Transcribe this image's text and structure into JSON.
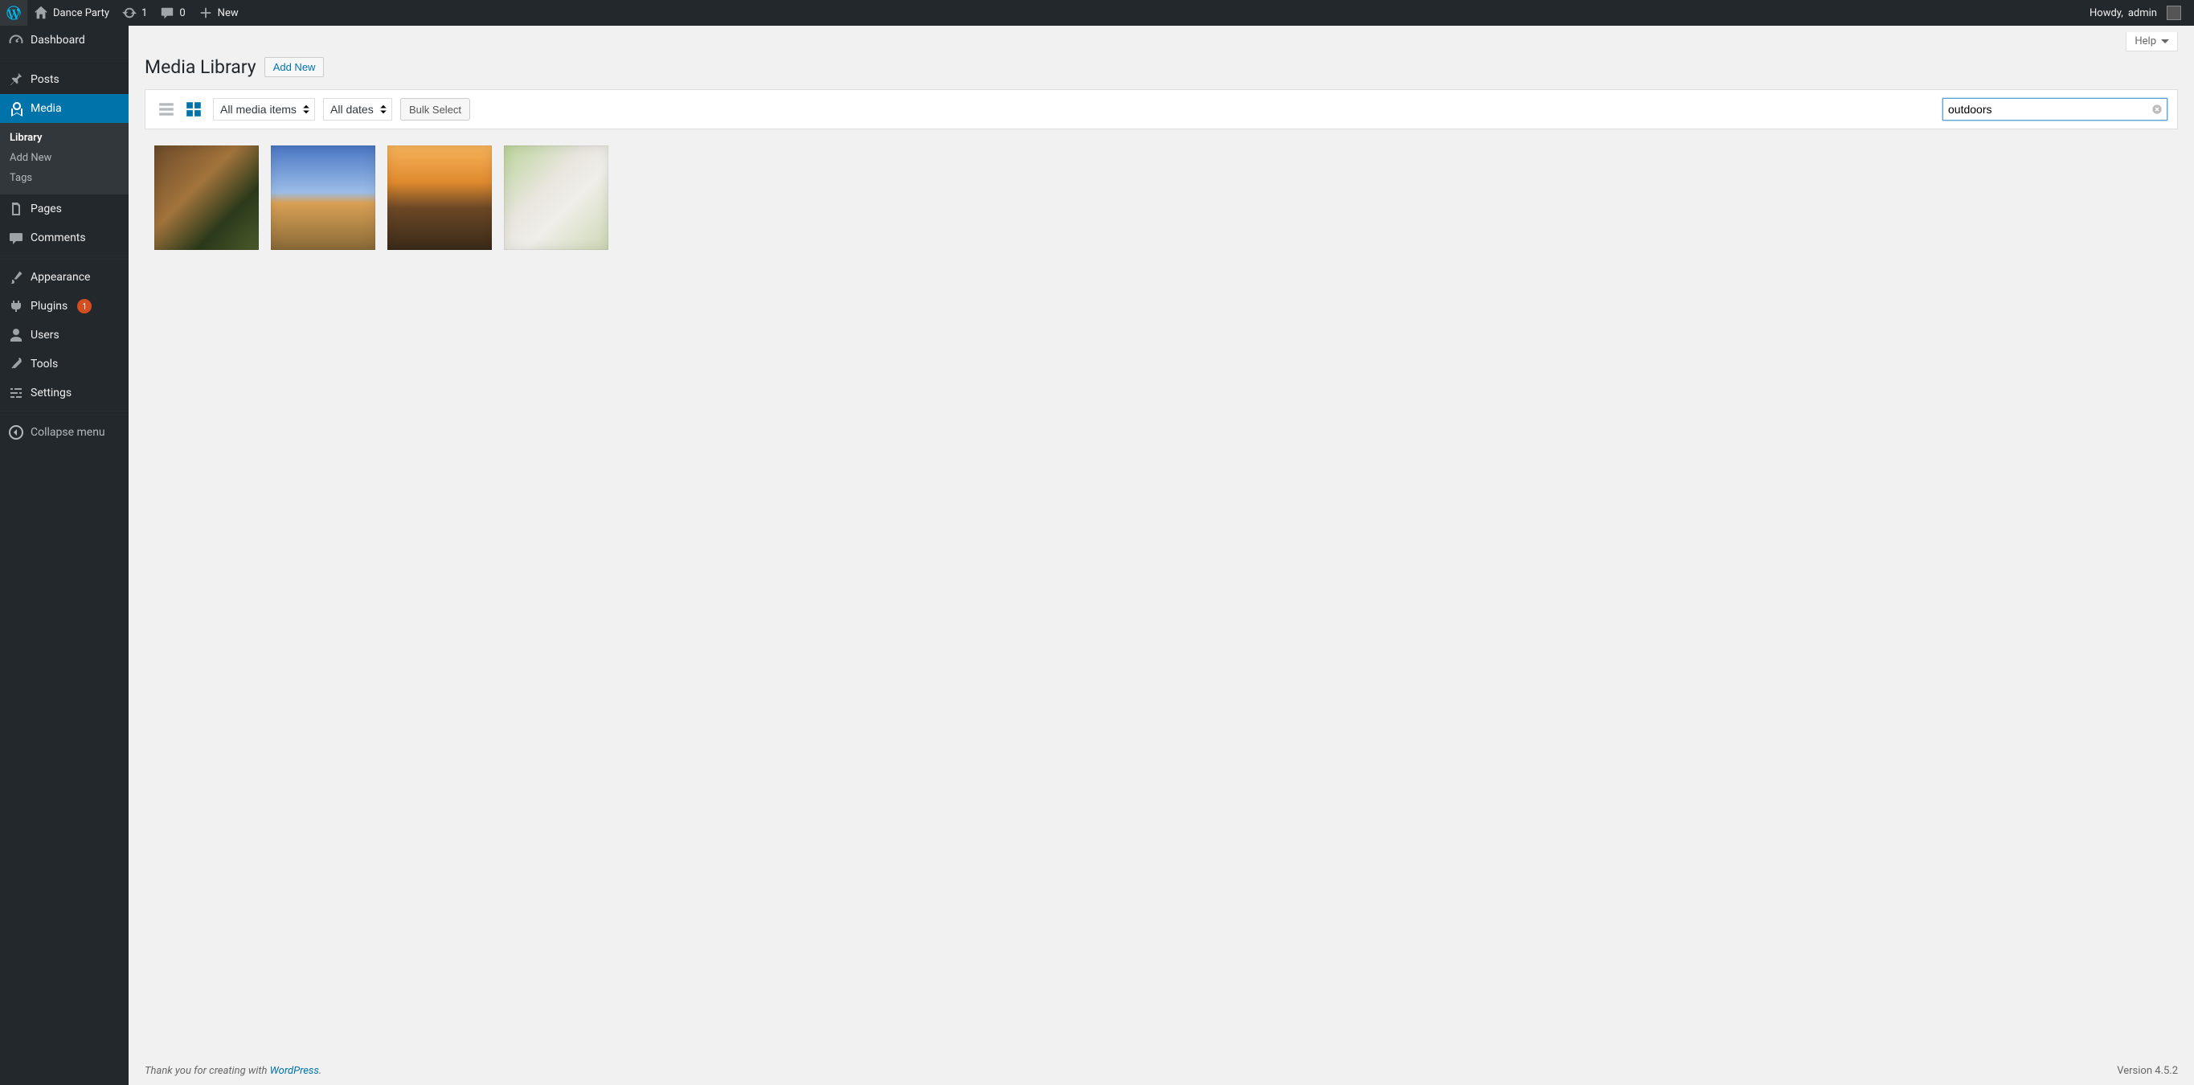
{
  "adminbar": {
    "site_name": "Dance Party",
    "updates_count": "1",
    "comments_count": "0",
    "new_label": "New",
    "howdy_prefix": "Howdy, ",
    "username": "admin"
  },
  "sidebar": {
    "dashboard": "Dashboard",
    "posts": "Posts",
    "media": "Media",
    "media_sub": {
      "library": "Library",
      "add_new": "Add New",
      "tags": "Tags"
    },
    "pages": "Pages",
    "comments": "Comments",
    "appearance": "Appearance",
    "plugins": "Plugins",
    "plugins_badge": "1",
    "users": "Users",
    "tools": "Tools",
    "settings": "Settings",
    "collapse": "Collapse menu"
  },
  "page": {
    "title": "Media Library",
    "add_new": "Add New",
    "help": "Help"
  },
  "toolbar": {
    "filter_type_selected": "All media items",
    "filter_date_selected": "All dates",
    "bulk_select": "Bulk Select",
    "search_value": "outdoors",
    "search_placeholder": "Search"
  },
  "footer": {
    "thankyou_prefix": "Thank you for creating with ",
    "wordpress": "WordPress",
    "period": ".",
    "version": "Version 4.5.2"
  }
}
